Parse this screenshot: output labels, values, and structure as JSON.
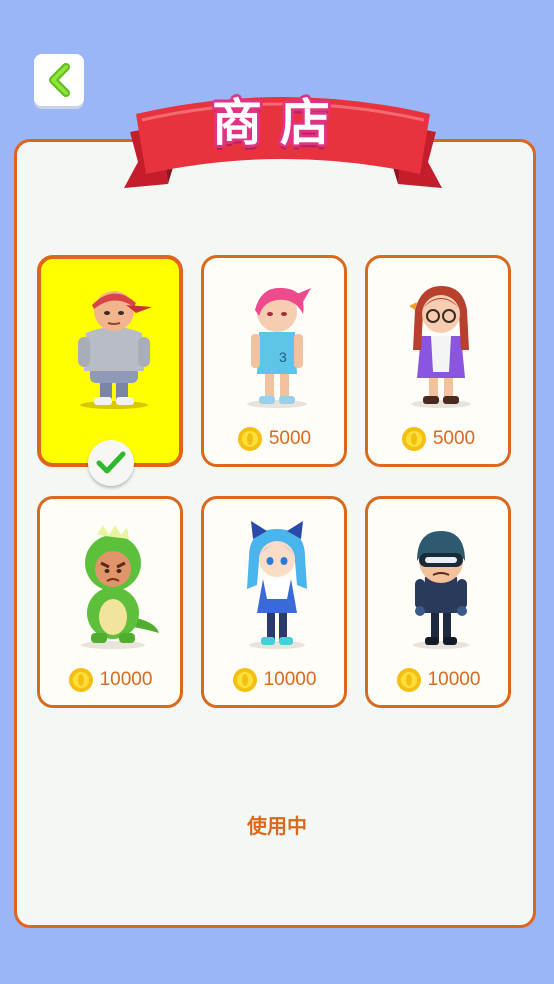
{
  "header": {
    "title": "商店",
    "back_icon": "chevron-left-icon",
    "accent": "#7ed321"
  },
  "shop": {
    "currency_icon": "coin-icon",
    "items": [
      {
        "name": "boy-cap-hoodie",
        "price": "",
        "selected": true
      },
      {
        "name": "girl-pink-hair",
        "price": "5000"
      },
      {
        "name": "girl-glasses",
        "price": "5000"
      },
      {
        "name": "dino-costume-boy",
        "price": "10000"
      },
      {
        "name": "cat-ear-girl",
        "price": "10000"
      },
      {
        "name": "helmet-rider",
        "price": "10000"
      }
    ]
  },
  "status": {
    "label": "使用中"
  },
  "colors": {
    "background": "#9bb6f7",
    "panel_border": "#e0641c",
    "selected_bg": "#ffff00",
    "banner_red": "#e8333f"
  }
}
